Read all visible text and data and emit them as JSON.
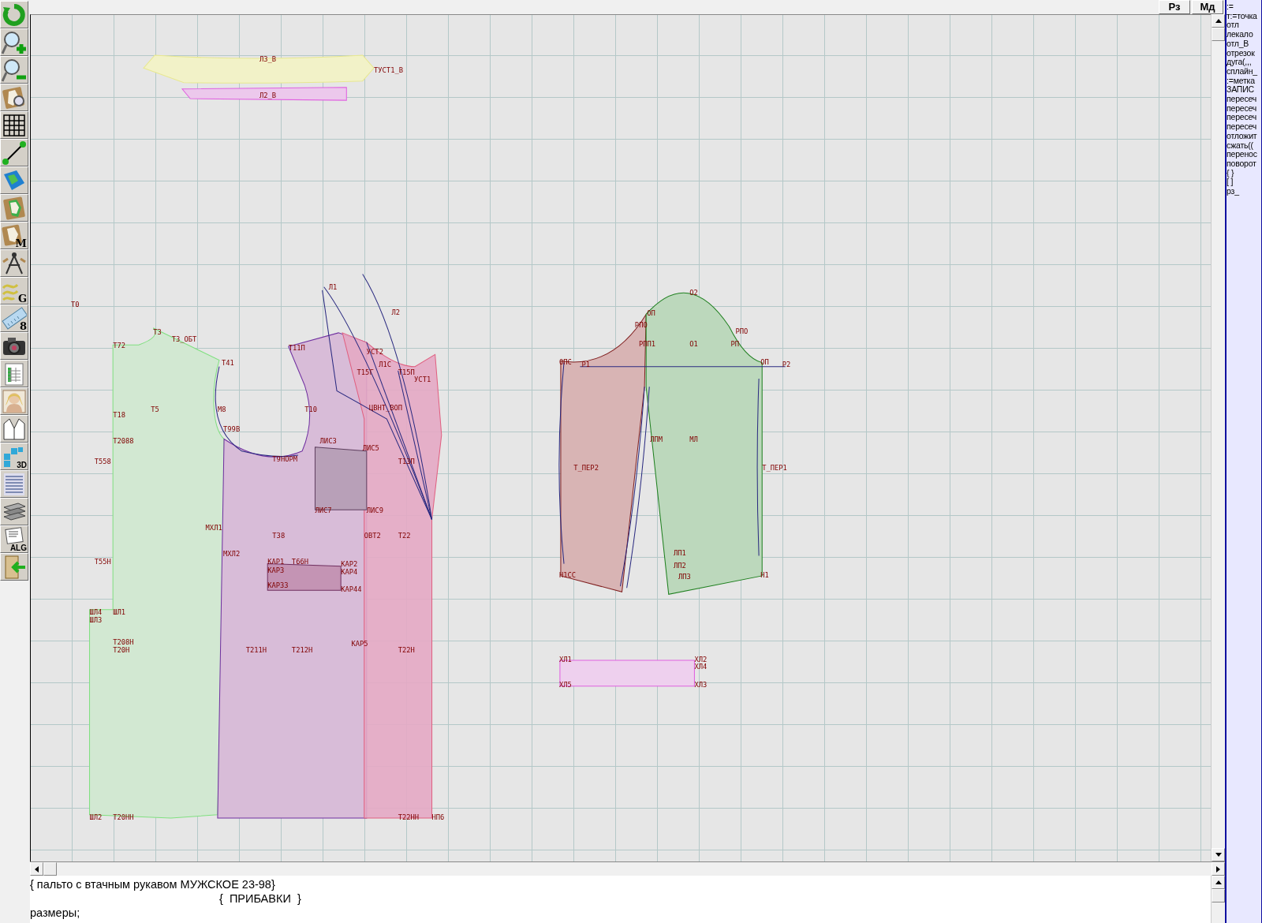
{
  "tools": [
    {
      "kind": "refresh"
    },
    {
      "kind": "zoom-in"
    },
    {
      "kind": "zoom-out"
    },
    {
      "kind": "pattern-search"
    },
    {
      "kind": "grid"
    },
    {
      "kind": "line"
    },
    {
      "kind": "map"
    },
    {
      "kind": "pattern"
    },
    {
      "kind": "pattern-letter",
      "label": "M"
    },
    {
      "kind": "compass"
    },
    {
      "kind": "curves",
      "label": "G"
    },
    {
      "kind": "ruler",
      "label": "8"
    },
    {
      "kind": "camera"
    },
    {
      "kind": "spreadsheet"
    },
    {
      "kind": "portrait"
    },
    {
      "kind": "jacket"
    },
    {
      "kind": "cubes",
      "label": "3D"
    },
    {
      "kind": "document-list"
    },
    {
      "kind": "books"
    },
    {
      "kind": "script",
      "label": "ALG"
    },
    {
      "kind": "exit"
    }
  ],
  "header_buttons": [
    "Рз",
    "Мд"
  ],
  "canvas": {
    "labels": [
      "Л3_В",
      "ТУСТ1_В",
      "Л2_В",
      "Т0",
      "Т3",
      "Т3_ОБТ",
      "Т72",
      "Т41",
      "Т5",
      "Т18",
      "М8",
      "Т99В",
      "Т2088",
      "Т558",
      "МХЛ1",
      "МХЛ2",
      "Т55Н",
      "ШЛ4",
      "ШЛ1",
      "ШЛ3",
      "Т208Н",
      "Т20Н",
      "ШЛ2",
      "Т20НН",
      "Л1",
      "Л2",
      "Т11П",
      "УСТ2",
      "Т15Г",
      "Л1С",
      "Т15П",
      "УСТ1",
      "Т10",
      "ЦВНТ_ВОП",
      "ЛИС3",
      "ЛИС5",
      "Т9НОРМ",
      "Т13П",
      "ЛИС7",
      "ЛИС9",
      "Т38",
      "ОВТ2",
      "Т22",
      "КАР1",
      "Т66Н",
      "КАР2",
      "КАР3",
      "КАР4",
      "КАР33",
      "КАР44",
      "КАР5",
      "Т211Н",
      "Т212Н",
      "Т22Н",
      "Т22НН",
      "НП6",
      "О2",
      "ОП",
      "РПО",
      "РПО",
      "РПП1",
      "О1",
      "РП",
      "ОПС",
      "Р1",
      "ОП",
      "Р2",
      "ЛПМ",
      "МЛ",
      "Т_ПЕР2",
      "Т_ПЕР1",
      "ЛП1",
      "ЛП2",
      "Н1СС",
      "ЛП3",
      "Н1",
      "ХЛ1",
      "ХЛ2",
      "ХЛ4",
      "ХЛ5",
      "ХЛ3"
    ]
  },
  "command_panel": {
    "items": [
      ":=",
      "т:=точка",
      "отл",
      "лекало",
      "отл_В",
      "отрезок",
      "дуга(,,,",
      "сплайн_",
      ":=метка",
      "ЗАПИС",
      "пересеч",
      "пересеч",
      "пересеч",
      "пересеч",
      "отложит",
      "сжать((",
      "перенос",
      "поворот",
      "{ }",
      "[ ]",
      "рз_"
    ]
  },
  "editor": {
    "lines": [
      "{ пальто с втачным рукавом МУЖСКОЕ 23-98}",
      "{  ПРИБАВКИ  }",
      "размеры;"
    ]
  }
}
